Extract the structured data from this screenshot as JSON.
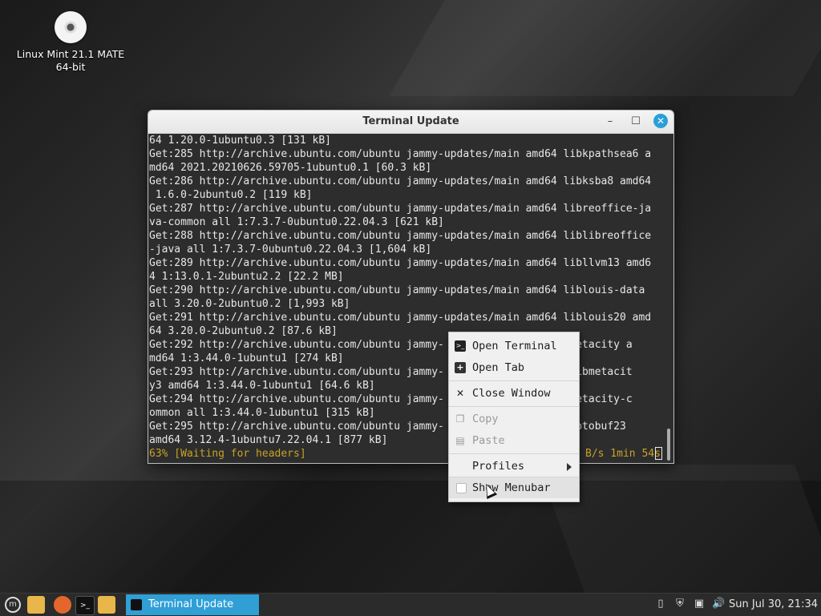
{
  "desktop": {
    "icon_label_line1": "Linux Mint 21.1 MATE",
    "icon_label_line2": "64-bit"
  },
  "window": {
    "title": "Terminal Update",
    "lines": [
      "64 1.20.0-1ubuntu0.3 [131 kB]",
      "Get:285 http://archive.ubuntu.com/ubuntu jammy-updates/main amd64 libkpathsea6 a",
      "md64 2021.20210626.59705-1ubuntu0.1 [60.3 kB]",
      "Get:286 http://archive.ubuntu.com/ubuntu jammy-updates/main amd64 libksba8 amd64",
      " 1.6.0-2ubuntu0.2 [119 kB]",
      "Get:287 http://archive.ubuntu.com/ubuntu jammy-updates/main amd64 libreoffice-ja",
      "va-common all 1:7.3.7-0ubuntu0.22.04.3 [621 kB]",
      "Get:288 http://archive.ubuntu.com/ubuntu jammy-updates/main amd64 liblibreoffice",
      "-java all 1:7.3.7-0ubuntu0.22.04.3 [1,604 kB]",
      "Get:289 http://archive.ubuntu.com/ubuntu jammy-updates/main amd64 libllvm13 amd6",
      "4 1:13.0.1-2ubuntu2.2 [22.2 MB]",
      "Get:290 http://archive.ubuntu.com/ubuntu jammy-updates/main amd64 liblouis-data",
      "all 3.20.0-2ubuntu0.2 [1,993 kB]",
      "Get:291 http://archive.ubuntu.com/ubuntu jammy-updates/main amd64 liblouis20 amd",
      "64 3.20.0-2ubuntu0.2 [87.6 kB]",
      "Get:292 http://archive.ubuntu.com/ubuntu jammy-                 64 metacity a",
      "md64 1:3.44.0-1ubuntu1 [274 kB]",
      "Get:293 http://archive.ubuntu.com/ubuntu jammy-                 64 libmetacit",
      "y3 amd64 1:3.44.0-1ubuntu1 [64.6 kB]",
      "Get:294 http://archive.ubuntu.com/ubuntu jammy-                 64 metacity-c",
      "ommon all 1:3.44.0-1ubuntu1 [315 kB]",
      "Get:295 http://archive.ubuntu.com/ubuntu jammy-                 ibprotobuf23",
      "amd64 3.12.4-1ubuntu7.22.04.1 [877 kB]"
    ],
    "status_left": "63% [Waiting for headers]",
    "status_right": "B/s 1min 54s"
  },
  "context_menu": {
    "items": [
      {
        "label": "Open Terminal",
        "icon": "terminal-icon"
      },
      {
        "label": "Open Tab",
        "icon": "new-tab-icon"
      },
      {
        "label": "Close Window",
        "icon": "close-icon"
      },
      {
        "label": "Copy",
        "icon": "copy-icon"
      },
      {
        "label": "Paste",
        "icon": "paste-icon"
      },
      {
        "label": "Profiles",
        "icon": "submenu-arrow-icon"
      },
      {
        "label": "Show Menubar",
        "icon": "checkbox-icon"
      }
    ]
  },
  "taskbar": {
    "active_task": "Terminal Update",
    "clock": "Sun Jul 30, 21:34"
  },
  "colors": {
    "accent": "#2f9fd6",
    "status_yellow": "#c9a227"
  }
}
